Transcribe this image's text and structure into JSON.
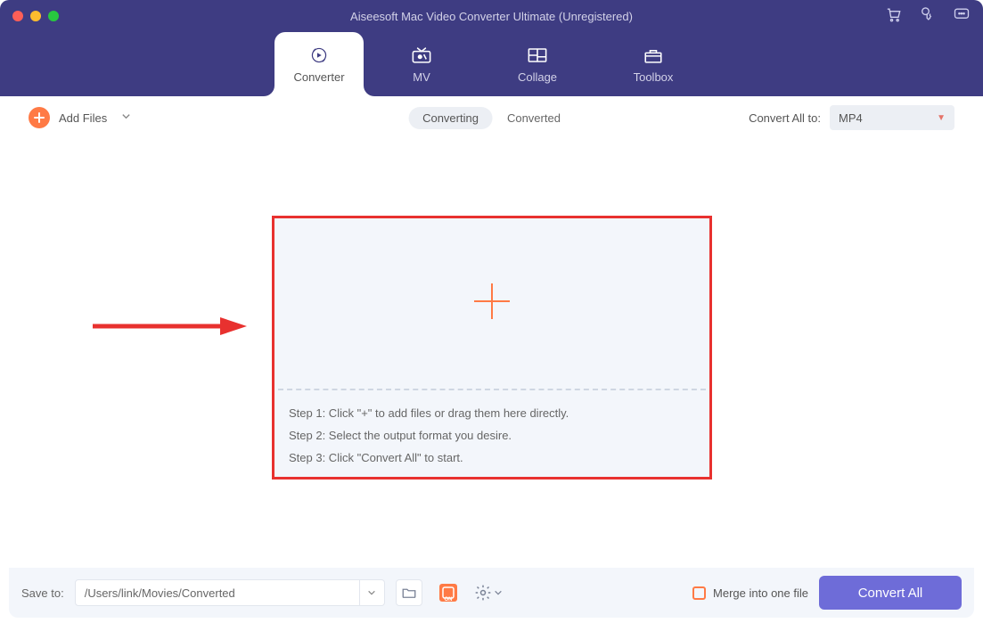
{
  "window": {
    "title": "Aiseesoft Mac Video Converter Ultimate (Unregistered)"
  },
  "tabs": {
    "converter": "Converter",
    "mv": "MV",
    "collage": "Collage",
    "toolbox": "Toolbox"
  },
  "toolbar": {
    "add_files": "Add Files",
    "subtabs": {
      "converting": "Converting",
      "converted": "Converted"
    },
    "convert_all_to": "Convert All to:",
    "format": "MP4"
  },
  "dropzone": {
    "step1": "Step 1: Click \"+\" to add files or drag them here directly.",
    "step2": "Step 2: Select the output format you desire.",
    "step3": "Step 3: Click \"Convert All\" to start."
  },
  "footer": {
    "save_to": "Save to:",
    "path": "/Users/link/Movies/Converted",
    "merge": "Merge into one file",
    "convert_all": "Convert All"
  }
}
